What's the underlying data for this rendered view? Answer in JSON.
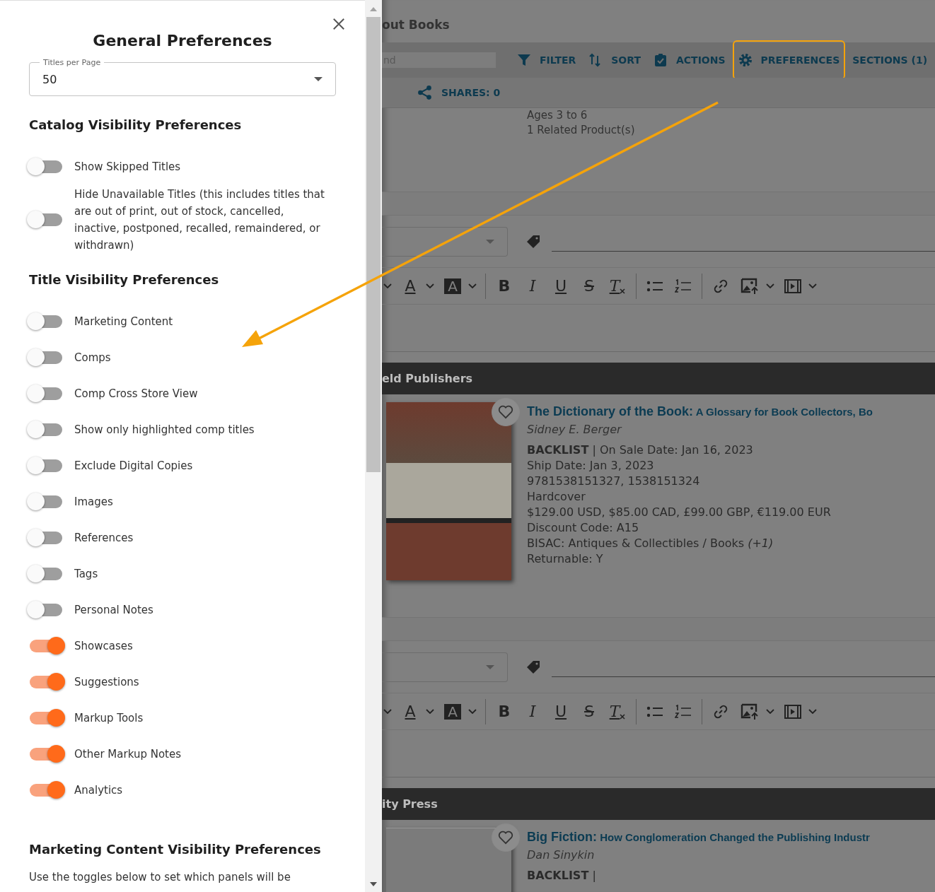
{
  "panel": {
    "title": "General Preferences",
    "titles_per_page": {
      "label": "Titles per Page",
      "value": "50"
    },
    "catalog": {
      "heading": "Catalog Visibility Preferences",
      "toggles": [
        {
          "label": "Show Skipped Titles",
          "on": false
        },
        {
          "label": "Hide Unavailable Titles (this includes titles that are out of print, out of stock, cancelled, inactive, postponed, recalled, remaindered, or withdrawn)",
          "on": false
        }
      ]
    },
    "title_visibility": {
      "heading": "Title Visibility Preferences",
      "toggles": [
        {
          "label": "Marketing Content",
          "on": false
        },
        {
          "label": "Comps",
          "on": false
        },
        {
          "label": "Comp Cross Store View",
          "on": false
        },
        {
          "label": "Show only highlighted comp titles",
          "on": false
        },
        {
          "label": "Exclude Digital Copies",
          "on": false
        },
        {
          "label": "Images",
          "on": false
        },
        {
          "label": "References",
          "on": false
        },
        {
          "label": "Tags",
          "on": false
        },
        {
          "label": "Personal Notes",
          "on": false
        },
        {
          "label": "Showcases",
          "on": true
        },
        {
          "label": "Suggestions",
          "on": true
        },
        {
          "label": "Markup Tools",
          "on": true
        },
        {
          "label": "Other Markup Notes",
          "on": true
        },
        {
          "label": "Analytics",
          "on": true
        }
      ]
    },
    "marketing": {
      "heading": "Marketing Content Visibility Preferences",
      "text": "Use the toggles below to set which panels will be"
    }
  },
  "background_page": {
    "header_title": "out Books",
    "search": {
      "placeholder": "nd"
    },
    "toolbar": [
      {
        "kind": "filter",
        "label": "FILTER",
        "highlighted": false
      },
      {
        "kind": "sort",
        "label": "SORT",
        "highlighted": false
      },
      {
        "kind": "actions",
        "label": "ACTIONS",
        "highlighted": false
      },
      {
        "kind": "preferences",
        "label": "PREFERENCES",
        "highlighted": true
      },
      {
        "kind": "sections",
        "label": "SECTIONS (1)",
        "highlighted": false
      }
    ],
    "shares": "SHARES: 0",
    "summary_lines": [
      "Ages 3 to 6",
      "1 Related Product(s)"
    ],
    "blocks": [
      {
        "editor_tools": [
          {
            "kind": "caret"
          },
          {
            "kind": "text-color",
            "glyph": "A"
          },
          {
            "kind": "caret"
          },
          {
            "kind": "highlight",
            "glyph": "A"
          },
          {
            "kind": "caret"
          },
          {
            "kind": "divider"
          },
          {
            "kind": "bold",
            "glyph": "B"
          },
          {
            "kind": "italic",
            "glyph": "I"
          },
          {
            "kind": "underline",
            "glyph": "U"
          },
          {
            "kind": "strike",
            "glyph": "S"
          },
          {
            "kind": "clear",
            "glyph": "T"
          },
          {
            "kind": "divider"
          },
          {
            "kind": "bullets"
          },
          {
            "kind": "numbered"
          },
          {
            "kind": "divider"
          },
          {
            "kind": "link"
          },
          {
            "kind": "image"
          },
          {
            "kind": "caret"
          },
          {
            "kind": "video"
          },
          {
            "kind": "caret"
          }
        ],
        "publisher": "eld Publishers",
        "book": {
          "title": "**The Dictionary of the Book:** A Glossary for Book Collectors, Bo",
          "author": "Sidney E. Berger",
          "details": [
            "**BACKLIST** | On Sale Date: Jan 16, 2023",
            "Ship Date: Jan 3, 2023",
            "9781538151327, 1538151324",
            "Hardcover",
            "$129.00 USD, $85.00 CAD, £99.00 GBP, €119.00 EUR",
            "Discount Code: A15",
            "BISAC: Antiques & Collectibles / Books *(+1)*",
            "Returnable: Y"
          ]
        }
      },
      {
        "editor_tools": [
          {
            "kind": "caret"
          },
          {
            "kind": "text-color",
            "glyph": "A"
          },
          {
            "kind": "caret"
          },
          {
            "kind": "highlight",
            "glyph": "A"
          },
          {
            "kind": "caret"
          },
          {
            "kind": "divider"
          },
          {
            "kind": "bold",
            "glyph": "B"
          },
          {
            "kind": "italic",
            "glyph": "I"
          },
          {
            "kind": "underline",
            "glyph": "U"
          },
          {
            "kind": "strike",
            "glyph": "S"
          },
          {
            "kind": "clear",
            "glyph": "T"
          },
          {
            "kind": "divider"
          },
          {
            "kind": "bullets"
          },
          {
            "kind": "numbered"
          },
          {
            "kind": "divider"
          },
          {
            "kind": "link"
          },
          {
            "kind": "image"
          },
          {
            "kind": "caret"
          },
          {
            "kind": "video"
          },
          {
            "kind": "caret"
          }
        ],
        "publisher": "ity Press",
        "book": {
          "title": "**Big Fiction:** How Conglomeration Changed the Publishing Industr",
          "author": "Dan Sinykin",
          "details": [
            "**BACKLIST** |"
          ]
        }
      }
    ]
  }
}
